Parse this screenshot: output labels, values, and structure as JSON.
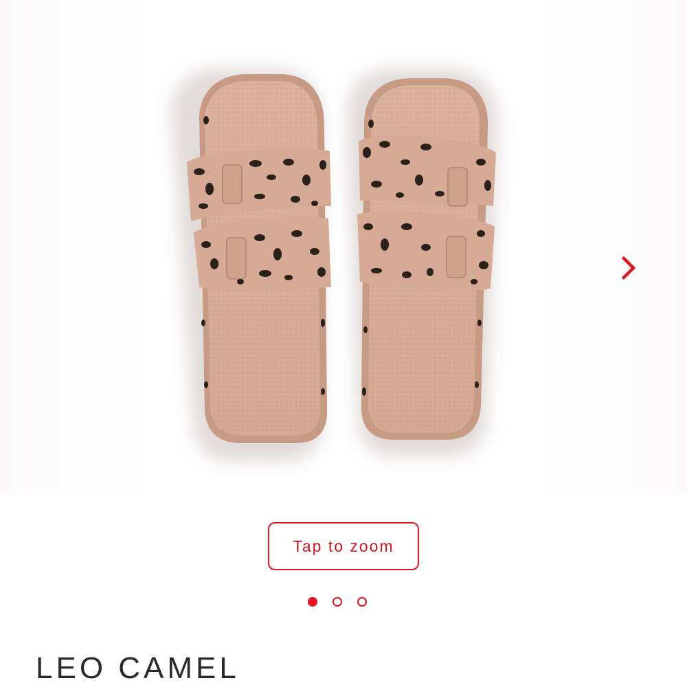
{
  "product": {
    "name": "LEO CAMEL",
    "image_alt": "leopard print sandals",
    "image_count": 3,
    "active_image": 1
  },
  "gallery": {
    "zoom_label": "Tap to zoom",
    "next_icon": "chevron-right-icon"
  },
  "colors": {
    "accent": "#e0141e",
    "sandal_base": "#d7ad98",
    "leopard_spot": "#2b211b",
    "title_text": "#2a2a2a"
  }
}
